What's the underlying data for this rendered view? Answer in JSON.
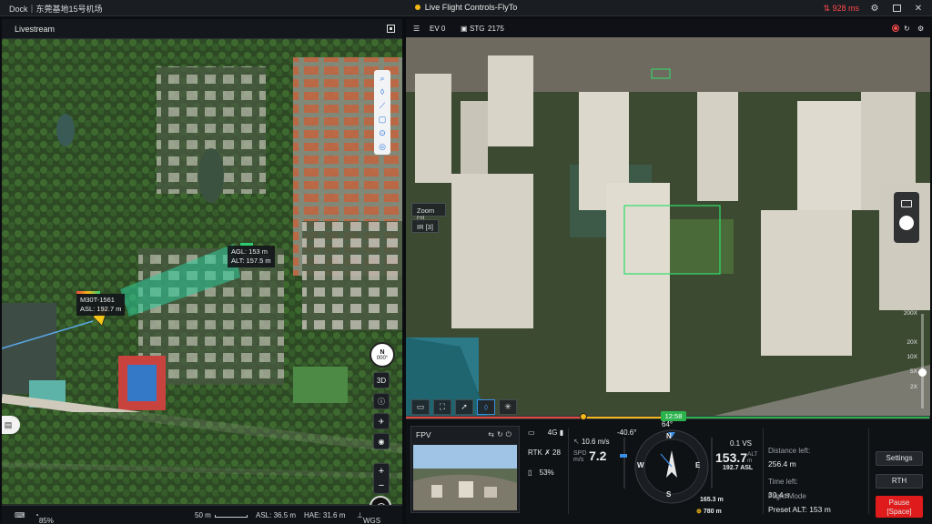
{
  "titlebar": {
    "app_name": "Dock｜东莞基地15号机场",
    "window_title": "Live Flight Controls-FlyTo",
    "speed_readout": "928 ms",
    "status_color": "#f5b915"
  },
  "map": {
    "title": "Livestream",
    "tools": [
      "search-icon",
      "waypoint-icon",
      "line-icon",
      "area-icon",
      "target-icon",
      "layers-icon"
    ],
    "compass": {
      "letter": "N",
      "heading": "000°"
    },
    "buttons": {
      "view3d": "3D"
    },
    "drone_label": {
      "name": "M30T-1561",
      "asl": "ASL: 192.7 m"
    },
    "alt_label": {
      "agl": "AGL: 153 m",
      "alt": "ALT: 157.5 m"
    },
    "footer": {
      "battery": "85%",
      "scale": "50 m",
      "asl": "ASL: 36.5 m",
      "hae": "HAE: 31.6 m",
      "datum": "WGS 84"
    }
  },
  "video": {
    "top": {
      "ev": "EV 0",
      "stg_label": "STG",
      "stg_value": "2175"
    },
    "lens": {
      "zoom": "Zoom [2]",
      "ir": "IR [3]"
    },
    "zoom_levels": [
      "200X",
      "20X",
      "10X",
      "5X",
      "2X"
    ],
    "zoom_level_current": "5X",
    "timeline_time": "12:58",
    "timeline_progress": 0.51
  },
  "hud": {
    "fpv_label": "FPV",
    "signal": {
      "label": "4G"
    },
    "rtk": {
      "label": "RTK",
      "count": "28"
    },
    "battery": "53%",
    "horizontal_speed": "10.6 m/s",
    "spd_label": "SPD",
    "spd_unit": "m/s",
    "spd_value": "7.2",
    "gimbal_pitch": "-40.6°",
    "compass_heading": "64°",
    "vs": "0.1 VS",
    "alt_value": "153.7",
    "alt_unit": "ALT",
    "alt_unit2": "m",
    "asl": "192.7 ASL",
    "home_alt": "165.3 m",
    "home_dist": "780 m",
    "compass_letters": [
      "N",
      "E",
      "S",
      "W"
    ]
  },
  "mission": {
    "distance_label": "Distance left:",
    "distance_value": "256.4 m",
    "time_label": "Time left:",
    "time_value": "30.4 s",
    "mode_label": "Flight Mode",
    "mode_value": "Preset ALT: 153 m"
  },
  "actions": {
    "settings": "Settings",
    "rth": "RTH",
    "pause": "Pause",
    "pause_key": "[Space]"
  }
}
